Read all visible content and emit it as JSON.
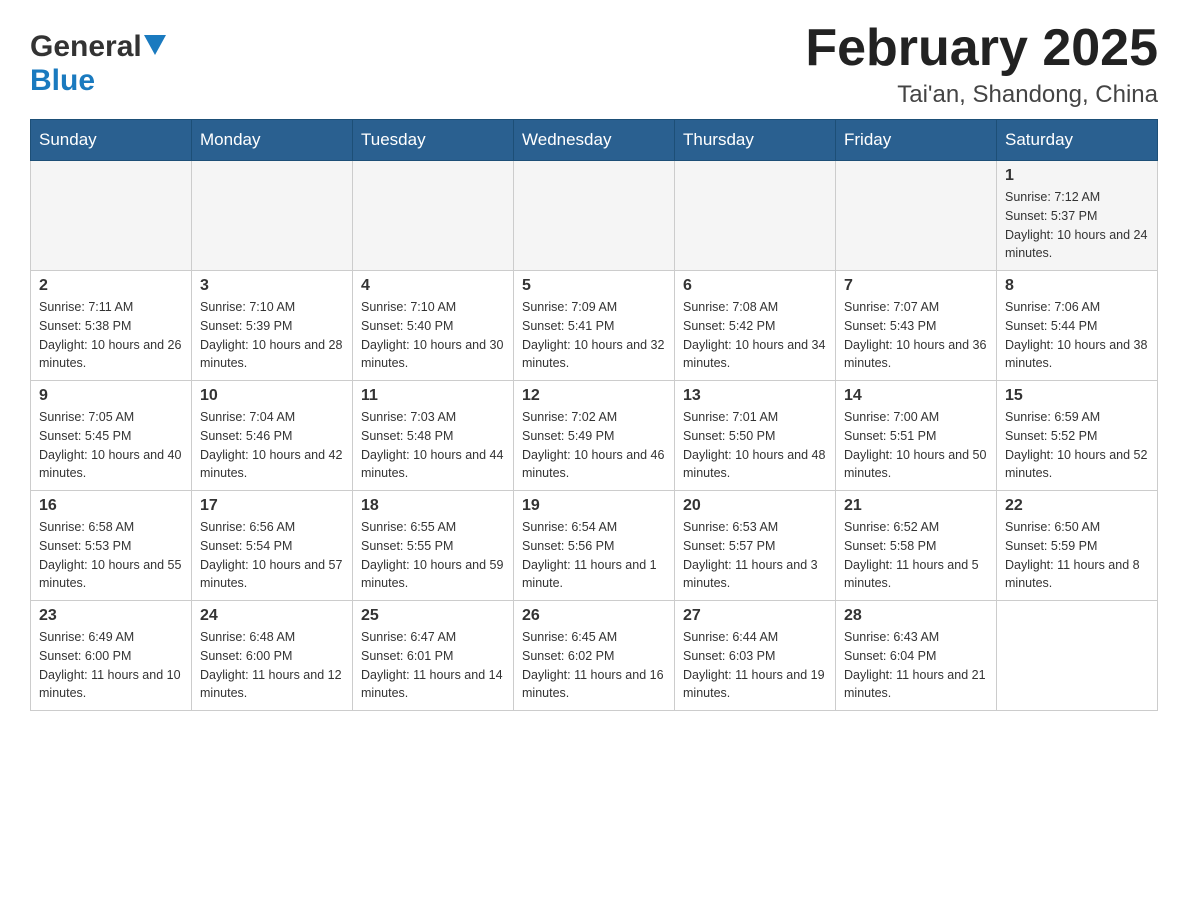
{
  "header": {
    "title": "February 2025",
    "subtitle": "Tai'an, Shandong, China",
    "logo_general": "General",
    "logo_blue": "Blue"
  },
  "days_of_week": [
    "Sunday",
    "Monday",
    "Tuesday",
    "Wednesday",
    "Thursday",
    "Friday",
    "Saturday"
  ],
  "weeks": [
    {
      "days": [
        {
          "num": "",
          "info": ""
        },
        {
          "num": "",
          "info": ""
        },
        {
          "num": "",
          "info": ""
        },
        {
          "num": "",
          "info": ""
        },
        {
          "num": "",
          "info": ""
        },
        {
          "num": "",
          "info": ""
        },
        {
          "num": "1",
          "info": "Sunrise: 7:12 AM\nSunset: 5:37 PM\nDaylight: 10 hours and 24 minutes."
        }
      ]
    },
    {
      "days": [
        {
          "num": "2",
          "info": "Sunrise: 7:11 AM\nSunset: 5:38 PM\nDaylight: 10 hours and 26 minutes."
        },
        {
          "num": "3",
          "info": "Sunrise: 7:10 AM\nSunset: 5:39 PM\nDaylight: 10 hours and 28 minutes."
        },
        {
          "num": "4",
          "info": "Sunrise: 7:10 AM\nSunset: 5:40 PM\nDaylight: 10 hours and 30 minutes."
        },
        {
          "num": "5",
          "info": "Sunrise: 7:09 AM\nSunset: 5:41 PM\nDaylight: 10 hours and 32 minutes."
        },
        {
          "num": "6",
          "info": "Sunrise: 7:08 AM\nSunset: 5:42 PM\nDaylight: 10 hours and 34 minutes."
        },
        {
          "num": "7",
          "info": "Sunrise: 7:07 AM\nSunset: 5:43 PM\nDaylight: 10 hours and 36 minutes."
        },
        {
          "num": "8",
          "info": "Sunrise: 7:06 AM\nSunset: 5:44 PM\nDaylight: 10 hours and 38 minutes."
        }
      ]
    },
    {
      "days": [
        {
          "num": "9",
          "info": "Sunrise: 7:05 AM\nSunset: 5:45 PM\nDaylight: 10 hours and 40 minutes."
        },
        {
          "num": "10",
          "info": "Sunrise: 7:04 AM\nSunset: 5:46 PM\nDaylight: 10 hours and 42 minutes."
        },
        {
          "num": "11",
          "info": "Sunrise: 7:03 AM\nSunset: 5:48 PM\nDaylight: 10 hours and 44 minutes."
        },
        {
          "num": "12",
          "info": "Sunrise: 7:02 AM\nSunset: 5:49 PM\nDaylight: 10 hours and 46 minutes."
        },
        {
          "num": "13",
          "info": "Sunrise: 7:01 AM\nSunset: 5:50 PM\nDaylight: 10 hours and 48 minutes."
        },
        {
          "num": "14",
          "info": "Sunrise: 7:00 AM\nSunset: 5:51 PM\nDaylight: 10 hours and 50 minutes."
        },
        {
          "num": "15",
          "info": "Sunrise: 6:59 AM\nSunset: 5:52 PM\nDaylight: 10 hours and 52 minutes."
        }
      ]
    },
    {
      "days": [
        {
          "num": "16",
          "info": "Sunrise: 6:58 AM\nSunset: 5:53 PM\nDaylight: 10 hours and 55 minutes."
        },
        {
          "num": "17",
          "info": "Sunrise: 6:56 AM\nSunset: 5:54 PM\nDaylight: 10 hours and 57 minutes."
        },
        {
          "num": "18",
          "info": "Sunrise: 6:55 AM\nSunset: 5:55 PM\nDaylight: 10 hours and 59 minutes."
        },
        {
          "num": "19",
          "info": "Sunrise: 6:54 AM\nSunset: 5:56 PM\nDaylight: 11 hours and 1 minute."
        },
        {
          "num": "20",
          "info": "Sunrise: 6:53 AM\nSunset: 5:57 PM\nDaylight: 11 hours and 3 minutes."
        },
        {
          "num": "21",
          "info": "Sunrise: 6:52 AM\nSunset: 5:58 PM\nDaylight: 11 hours and 5 minutes."
        },
        {
          "num": "22",
          "info": "Sunrise: 6:50 AM\nSunset: 5:59 PM\nDaylight: 11 hours and 8 minutes."
        }
      ]
    },
    {
      "days": [
        {
          "num": "23",
          "info": "Sunrise: 6:49 AM\nSunset: 6:00 PM\nDaylight: 11 hours and 10 minutes."
        },
        {
          "num": "24",
          "info": "Sunrise: 6:48 AM\nSunset: 6:00 PM\nDaylight: 11 hours and 12 minutes."
        },
        {
          "num": "25",
          "info": "Sunrise: 6:47 AM\nSunset: 6:01 PM\nDaylight: 11 hours and 14 minutes."
        },
        {
          "num": "26",
          "info": "Sunrise: 6:45 AM\nSunset: 6:02 PM\nDaylight: 11 hours and 16 minutes."
        },
        {
          "num": "27",
          "info": "Sunrise: 6:44 AM\nSunset: 6:03 PM\nDaylight: 11 hours and 19 minutes."
        },
        {
          "num": "28",
          "info": "Sunrise: 6:43 AM\nSunset: 6:04 PM\nDaylight: 11 hours and 21 minutes."
        },
        {
          "num": "",
          "info": ""
        }
      ]
    }
  ]
}
